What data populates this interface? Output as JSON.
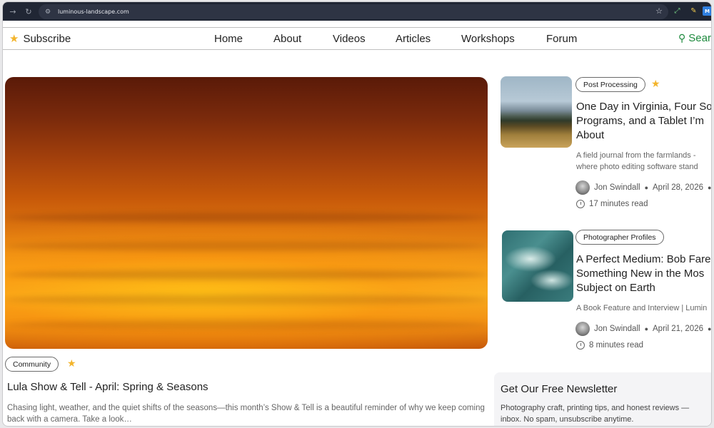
{
  "browser": {
    "url": "luminous-landscape.com"
  },
  "nav": {
    "subscribe_label": "Subscribe",
    "links": [
      "Home",
      "About",
      "Videos",
      "Articles",
      "Workshops",
      "Forum"
    ],
    "search_label": "Sear"
  },
  "hero": {
    "tag": "Community",
    "title": "Lula Show & Tell - April: Spring & Seasons",
    "excerpt": "Chasing light, weather, and the quiet shifts of the seasons—this month’s Show & Tell is a beautiful reminder of why we keep coming back with a camera. Take a look…"
  },
  "cards": [
    {
      "tag": "Post Processing",
      "title_lines": [
        "One Day in Virginia, Four So",
        "Programs, and a Tablet I’m",
        "About"
      ],
      "excerpt_lines": [
        "A field journal from the farmlands -",
        "where photo editing software stand"
      ],
      "author": "Jon Swindall",
      "date": "April 28, 2026",
      "read_time": "17 minutes read"
    },
    {
      "tag": "Photographer Profiles",
      "title_lines": [
        "A Perfect Medium: Bob Fare",
        "Something New in the Mos",
        "Subject on Earth"
      ],
      "excerpt_lines": [
        "A Book Feature and Interview | Lumin"
      ],
      "author": "Jon Swindall",
      "date": "April 21, 2026",
      "read_time": "8 minutes read"
    }
  ],
  "newsletter": {
    "title": "Get Our Free Newsletter",
    "text_lines": [
      "Photography craft, printing tips, and honest reviews —",
      "inbox. No spam, unsubscribe anytime."
    ]
  },
  "colors": {
    "accent_star": "#f3b42b",
    "search_green": "#1e8a3e",
    "chrome_bg": "#202634"
  }
}
